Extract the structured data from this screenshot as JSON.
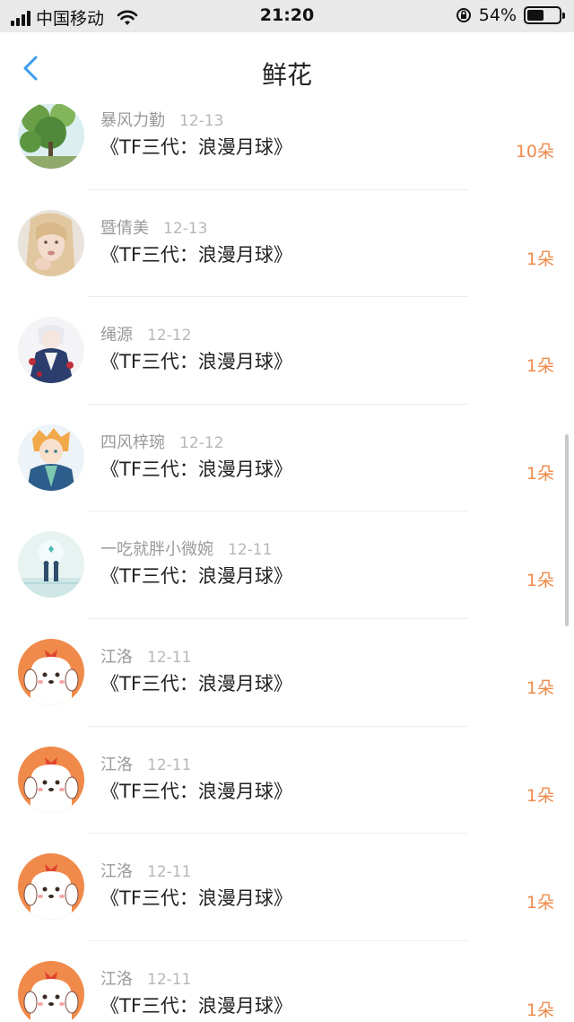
{
  "status_bar": {
    "carrier": "中国移动",
    "time": "21:20",
    "battery_percent_label": "54%",
    "battery_level": 0.54
  },
  "header": {
    "title": "鲜花"
  },
  "items": [
    {
      "username": "暴风力勤",
      "date": "12-13",
      "title": "《TF三代：浪漫月球》",
      "count": "10朵",
      "avatar_icon": "tree-photo-avatar"
    },
    {
      "username": "暨倩美",
      "date": "12-13",
      "title": "《TF三代：浪漫月球》",
      "count": "1朵",
      "avatar_icon": "blonde-girl-avatar"
    },
    {
      "username": "绳源",
      "date": "12-12",
      "title": "《TF三代：浪漫月球》",
      "count": "1朵",
      "avatar_icon": "anime-girl-avatar"
    },
    {
      "username": "四风梓琬",
      "date": "12-12",
      "title": "《TF三代：浪漫月球》",
      "count": "1朵",
      "avatar_icon": "anime-boy-avatar"
    },
    {
      "username": "一吃就胖小微婉",
      "date": "12-11",
      "title": "《TF三代：浪漫月球》",
      "count": "1朵",
      "avatar_icon": "couple-sky-avatar"
    },
    {
      "username": "江洛",
      "date": "12-11",
      "title": "《TF三代：浪漫月球》",
      "count": "1朵",
      "avatar_icon": "cartoon-dog-avatar"
    },
    {
      "username": "江洛",
      "date": "12-11",
      "title": "《TF三代：浪漫月球》",
      "count": "1朵",
      "avatar_icon": "cartoon-dog-avatar"
    },
    {
      "username": "江洛",
      "date": "12-11",
      "title": "《TF三代：浪漫月球》",
      "count": "1朵",
      "avatar_icon": "cartoon-dog-avatar"
    },
    {
      "username": "江洛",
      "date": "12-11",
      "title": "《TF三代：浪漫月球》",
      "count": "1朵",
      "avatar_icon": "cartoon-dog-avatar"
    }
  ],
  "colors": {
    "accent": "#f08a4b",
    "back": "#3b9cf0"
  }
}
